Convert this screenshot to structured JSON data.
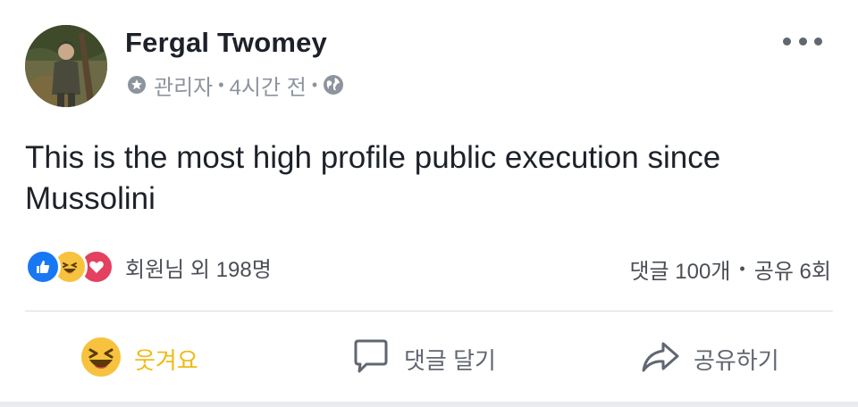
{
  "author": {
    "name": "Fergal Twomey",
    "role": "관리자",
    "time": "4시간 전",
    "privacy_icon": "globe-icon",
    "role_icon": "admin-badge-icon"
  },
  "post": {
    "text": "This is the most high profile public execution since Mussolini"
  },
  "reactions": {
    "icons": [
      "like-icon",
      "haha-icon",
      "love-icon"
    ],
    "summary": "회원님 외 198명"
  },
  "engagement": {
    "comments": "댓글 100개",
    "shares": "공유 6회"
  },
  "actions": {
    "reaction_label": "웃겨요",
    "comment_label": "댓글 달기",
    "share_label": "공유하기"
  },
  "colors": {
    "name": "#1d2129",
    "meta": "#8d949e",
    "like": "#1877f2",
    "haha": "#f7c23d",
    "love": "#e4405f",
    "haha_label": "#f0ba15",
    "divider": "#dadde1"
  }
}
